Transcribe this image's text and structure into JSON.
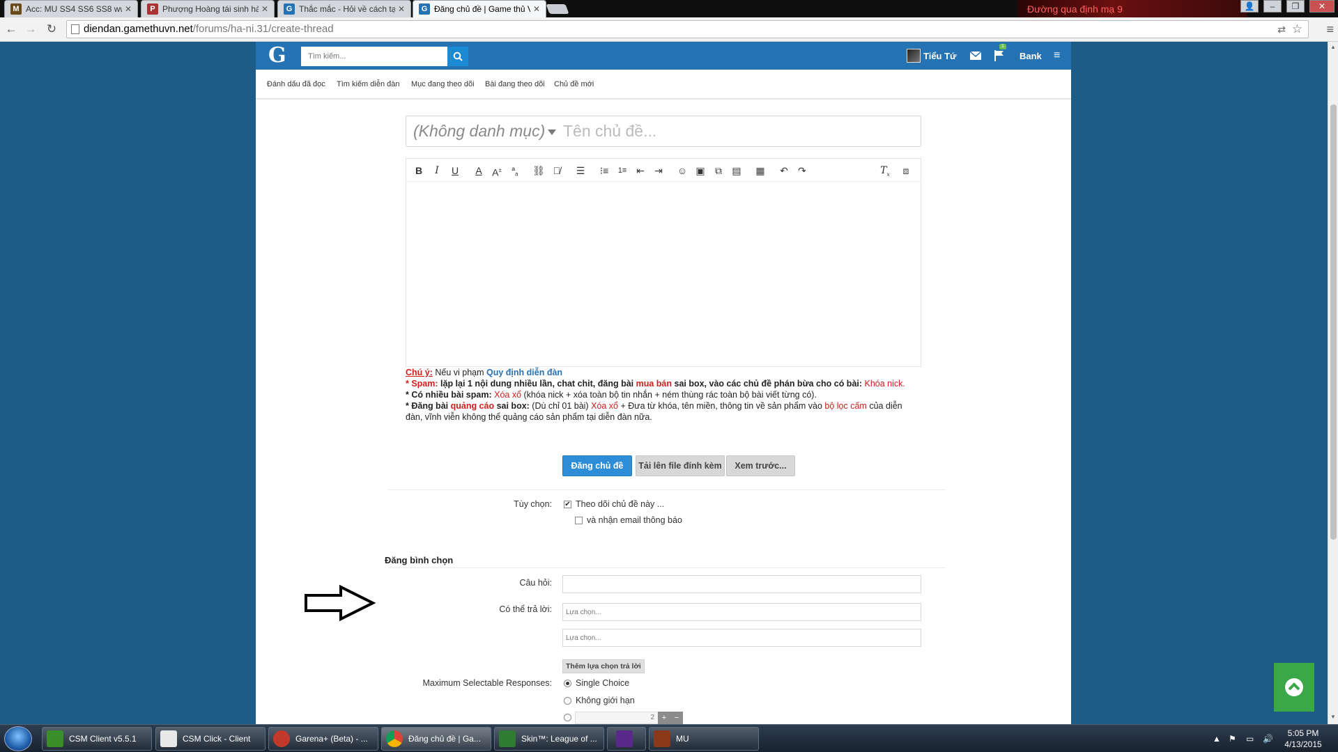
{
  "browser": {
    "tabs": [
      {
        "title": "Acc: MU SS4 SS6 SS8 www...",
        "active": false
      },
      {
        "title": "Phượng Hoàng tái sinh hà...",
        "active": false
      },
      {
        "title": "Thắc mắc - Hỏi về cách tạ...",
        "active": false
      },
      {
        "title": "Đăng chủ đề | Game thủ V...",
        "active": true
      }
    ],
    "url_host": "diendan.gamethuvn.net",
    "url_path": "/forums/ha-ni.31/create-thread",
    "banner_text": "Đường qua định mạ 9"
  },
  "header": {
    "logo": "G",
    "search_placeholder": "Tìm kiếm...",
    "username": "Tiểu Tứ",
    "notification_count": "1",
    "bank_label": "Bank"
  },
  "subnav": {
    "items": [
      "Đánh dấu đã đọc",
      "Tìm kiếm diễn đàn",
      "Mục đang theo dõi",
      "Bài đang theo dõi",
      "Chủ đề mới"
    ]
  },
  "thread": {
    "prefix": "(Không danh mục)",
    "title_placeholder": "Tên chủ đề..."
  },
  "toolbar": {
    "icons": [
      "bold-icon",
      "italic-icon",
      "underline-icon",
      "font-color-icon",
      "font-size-icon",
      "font-family-icon",
      "link-icon",
      "unlink-icon",
      "align-icon",
      "bullet-list-icon",
      "numbered-list-icon",
      "outdent-icon",
      "indent-icon",
      "smilie-icon",
      "image-icon",
      "media-icon",
      "insert-icon",
      "save-draft-icon",
      "undo-icon",
      "redo-icon",
      "remove-format-icon",
      "bbcode-toggle-icon"
    ]
  },
  "notice": {
    "line1_label": "Chú ý:",
    "line1_text": " Nếu vi phạm ",
    "line1_link": "Quy định diễn đàn",
    "spam_label": "* Spam:",
    "spam_text": " lặp lại 1 nội dung nhiều lần, chat chit, đăng bài ",
    "spam_red": "mua bán",
    "spam_text2": " sai box, vào các chủ đề phán bừa cho có bài: ",
    "spam_red2": "Khóa nick.",
    "multi_label": "* Có nhiều bài spam:",
    "multi_red": " Xóa xổ",
    "multi_text": " (khóa nick + xóa toàn bộ tin nhắn + ném thùng rác toàn bộ bài viết từng có).",
    "ads_label1": "* Đăng bài ",
    "ads_red_label": "quảng cáo",
    "ads_label2": " sai box:",
    "ads_text": " (Dù chỉ 01 bài) ",
    "ads_red": "Xóa xổ",
    "ads_text2": " + Đưa từ khóa, tên miền, thông tin về sản phẩm vào ",
    "ads_red2": "bộ lọc cấm",
    "ads_text3": " của diễn đàn, vĩnh viễn không thể quảng cáo sản phẩm tại diễn đàn nữa."
  },
  "buttons": {
    "post": "Đăng chủ đề",
    "upload": "Tải lên file đính kèm",
    "preview": "Xem trước..."
  },
  "options": {
    "label": "Tùy chọn:",
    "watch": "Theo dõi chủ đề này ...",
    "watch_checked": true,
    "email": "và nhận email thông báo",
    "email_checked": false
  },
  "poll": {
    "title": "Đăng bình chọn",
    "question_label": "Câu hỏi:",
    "responses_label": "Có thể trả lời:",
    "choice_placeholder": "Lựa chọn...",
    "add_choice": "Thêm lựa chọn trả lời",
    "max_label": "Maximum Selectable Responses:",
    "single": "Single Choice",
    "unlimited": "Không giới hạn",
    "stepper_value": "2"
  },
  "taskbar": {
    "items": [
      {
        "label": "CSM Client v5.5.1",
        "color": "#3a8f2a"
      },
      {
        "label": "CSM Click - Client",
        "color": "#e8e8e8"
      },
      {
        "label": "Garena+ (Beta) - ...",
        "color": "#c0392b"
      },
      {
        "label": "Đăng chủ đề | Ga...",
        "color": "#f1c40f"
      },
      {
        "label": "Skin™: League of ...",
        "color": "#2e7d32"
      },
      {
        "label": "",
        "color": "#5a2a8a"
      },
      {
        "label": "MU",
        "color": "#8a3a1a"
      }
    ],
    "time": "5:05 PM",
    "date": "4/13/2015"
  },
  "colors": {
    "site_blue": "#2673b3",
    "page_bg": "#1e5c88",
    "primary_button": "#2d8ed7",
    "warning_red": "#d01d1d",
    "back_to_top": "#3aa748"
  }
}
